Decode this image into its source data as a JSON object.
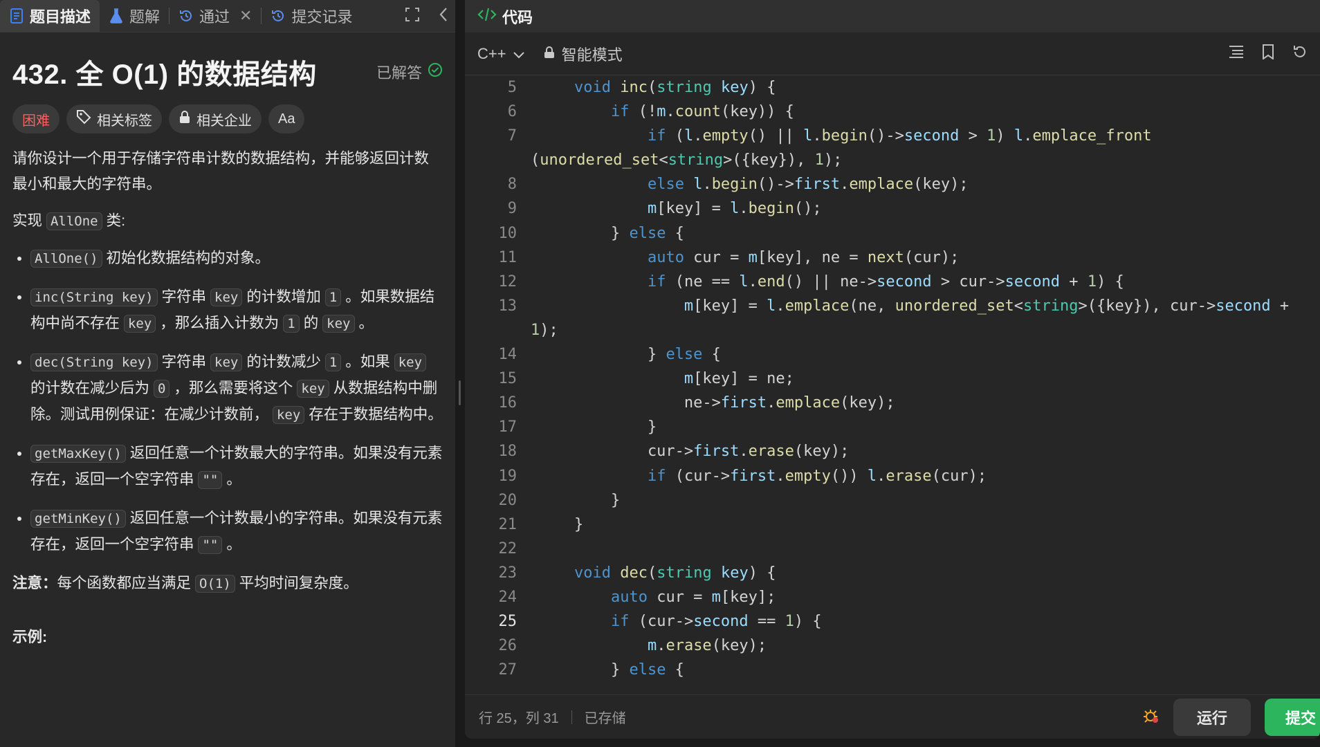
{
  "left": {
    "tabs": [
      {
        "label": "题目描述",
        "icon": "description-icon"
      },
      {
        "label": "题解",
        "icon": "flask-icon"
      },
      {
        "label": "通过",
        "icon": "history-icon"
      },
      {
        "label": "提交记录",
        "icon": "history-icon"
      }
    ],
    "title": "432. 全 O(1) 的数据结构",
    "status": "已解答",
    "tags": {
      "difficulty": "困难",
      "related_tags": "相关标签",
      "related_companies": "相关企业",
      "font": "Aa"
    },
    "desc": {
      "p1": "请你设计一个用于存储字符串计数的数据结构，并能够返回计数最小和最大的字符串。",
      "p2a": "实现 ",
      "p2code": "AllOne",
      "p2b": " 类:",
      "b1code": "AllOne()",
      "b1": " 初始化数据结构的对象。",
      "b2code": "inc(String key)",
      "b2a": " 字符串 ",
      "b2key": "key",
      "b2b": " 的计数增加 ",
      "b2one": "1",
      "b2c": " 。如果数据结构中尚不存在 ",
      "b2key2": "key",
      "b2d": " ，那么插入计数为 ",
      "b2one2": "1",
      "b2e": " 的 ",
      "b2key3": "key",
      "b2f": " 。",
      "b3code": "dec(String key)",
      "b3a": " 字符串 ",
      "b3key": "key",
      "b3b": " 的计数减少 ",
      "b3one": "1",
      "b3c": " 。如果 ",
      "b3key2": "key",
      "b3d": " 的计数在减少后为 ",
      "b3zero": "0",
      "b3e": " ，那么需要将这个 ",
      "b3key3": "key",
      "b3f": " 从数据结构中删除。测试用例保证：在减少计数前， ",
      "b3key4": "key",
      "b3g": " 存在于数据结构中。",
      "b4code": "getMaxKey()",
      "b4a": " 返回任意一个计数最大的字符串。如果没有元素存在，返回一个空字符串 ",
      "b4empty": "\"\"",
      "b4b": " 。",
      "b5code": "getMinKey()",
      "b5a": " 返回任意一个计数最小的字符串。如果没有元素存在，返回一个空字符串 ",
      "b5empty": "\"\"",
      "b5b": " 。",
      "note_label": "注意：",
      "note_a": "每个函数都应当满足 ",
      "note_code": "O(1)",
      "note_b": " 平均时间复杂度。",
      "example": "示例:"
    }
  },
  "right": {
    "header_title": "代码",
    "language": "C++",
    "mode": "智能模式",
    "status": {
      "position": "行 25，列 31",
      "saved": "已存储",
      "run": "运行",
      "submit": "提交"
    }
  },
  "code": {
    "current_line": 25
  }
}
